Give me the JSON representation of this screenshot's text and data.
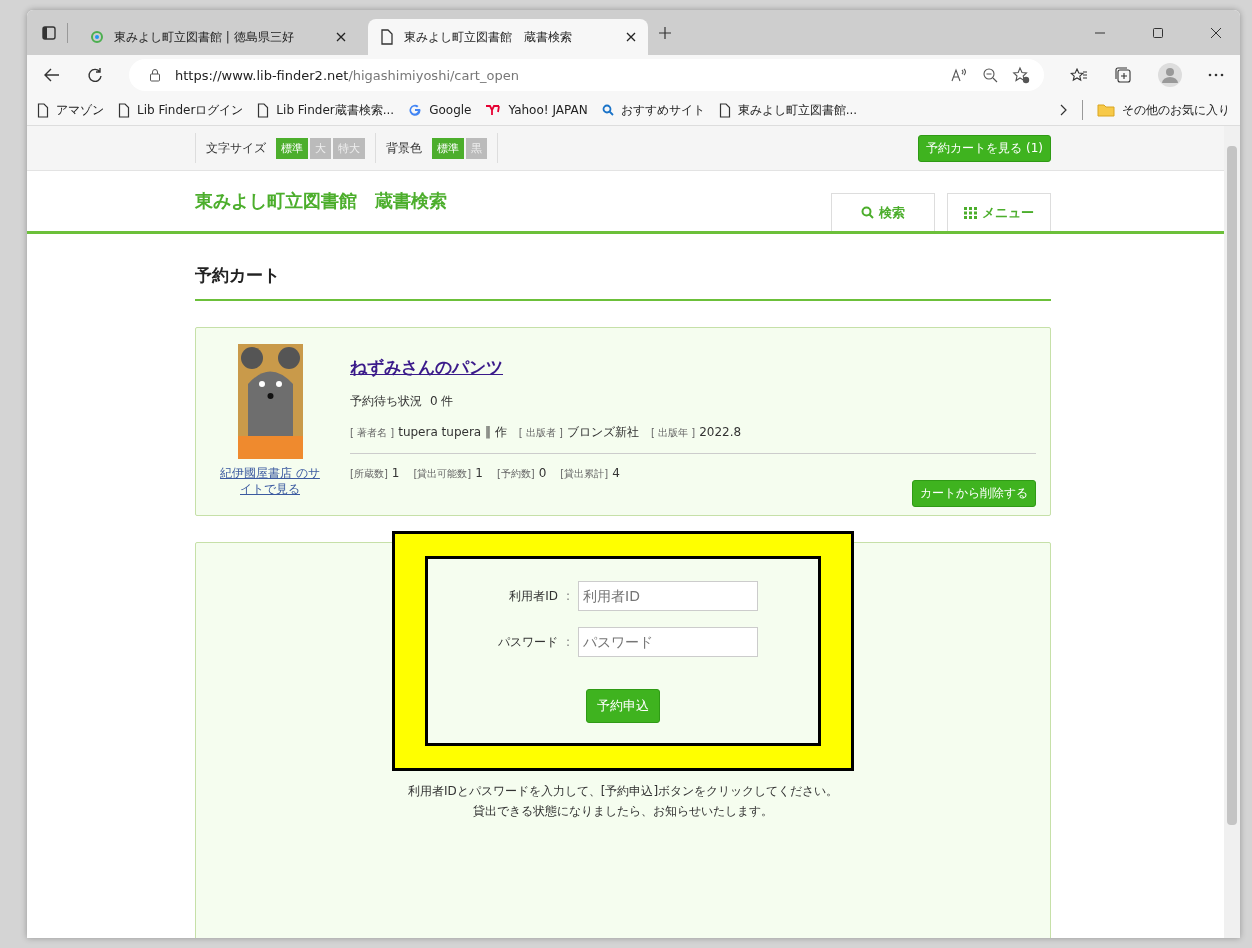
{
  "browser": {
    "tabs": [
      {
        "title": "東みよし町立図書館 | 徳島県三好",
        "kind": "logo",
        "selected": false
      },
      {
        "title": "東みよし町立図書館　蔵書検索",
        "kind": "page",
        "selected": true
      }
    ],
    "url_host": "https://www.lib-finder2.net",
    "url_path": "/higashimiyoshi/cart_open",
    "bookmarks": [
      {
        "label": "アマゾン",
        "kind": "page"
      },
      {
        "label": "Lib Finderログイン",
        "kind": "page"
      },
      {
        "label": "Lib Finder蔵書検索...",
        "kind": "page"
      },
      {
        "label": "Google",
        "kind": "google"
      },
      {
        "label": "Yahoo! JAPAN",
        "kind": "yahoo"
      },
      {
        "label": "おすすめサイト",
        "kind": "search"
      },
      {
        "label": "東みよし町立図書館...",
        "kind": "page"
      }
    ],
    "other_bookmarks": "その他のお気に入り"
  },
  "page": {
    "font_size": {
      "label": "文字サイズ",
      "options": [
        {
          "label": "標準",
          "selected": true
        },
        {
          "label": "大",
          "selected": false
        },
        {
          "label": "特大",
          "selected": false
        }
      ]
    },
    "bg_color": {
      "label": "背景色",
      "options": [
        {
          "label": "標準",
          "selected": true
        },
        {
          "label": "黒",
          "selected": false
        }
      ]
    },
    "cart_button": "予約カートを見る (1)",
    "site_title": "東みよし町立図書館　蔵書検索",
    "nav": [
      {
        "label": "検索",
        "kind": "search"
      },
      {
        "label": "メニュー",
        "kind": "grid"
      }
    ],
    "heading": "予約カート",
    "book": {
      "title": "ねずみさんのパンツ",
      "wait_label": "予約待ち状況",
      "wait_value": "0 件",
      "meta": [
        {
          "label": "[ 著者名 ]",
          "value": "tupera tupera ‖ 作"
        },
        {
          "label": "[ 出版者 ]",
          "value": "ブロンズ新社"
        },
        {
          "label": "[ 出版年 ]",
          "value": "2022.8"
        }
      ],
      "stats": [
        {
          "label": "[所蔵数]",
          "value": "1"
        },
        {
          "label": "[貸出可能数]",
          "value": "1"
        },
        {
          "label": "[予約数]",
          "value": "0"
        },
        {
          "label": "[貸出累計]",
          "value": "4"
        }
      ],
      "store_link": "紀伊國屋書店 のサイトで見る",
      "remove_button": "カートから削除する"
    },
    "form": {
      "fields": [
        {
          "label": "利用者ID",
          "separator": ":",
          "placeholder": "利用者ID"
        },
        {
          "label": "パスワード",
          "separator": ":",
          "placeholder": "パスワード"
        }
      ],
      "submit": "予約申込",
      "highlighted": true
    },
    "notes": [
      "利用者IDとパスワードを入力して、[予約申込]ボタンをクリックしてください。",
      "貸出できる状態になりましたら、お知らせいたします。"
    ]
  }
}
